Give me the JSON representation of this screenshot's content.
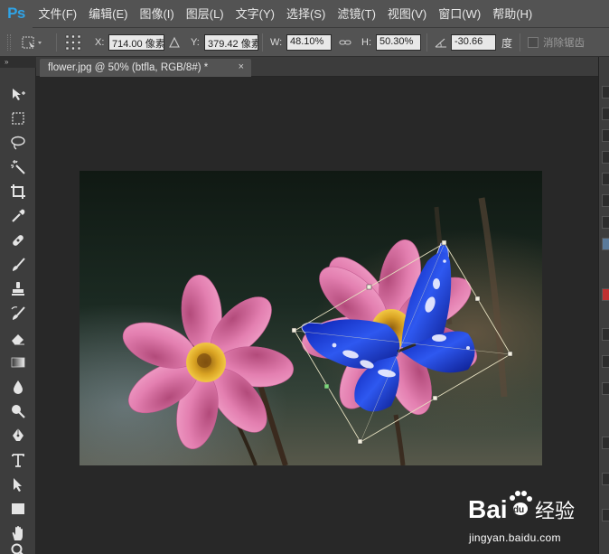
{
  "app": {
    "logo": "Ps"
  },
  "menu": [
    "文件(F)",
    "编辑(E)",
    "图像(I)",
    "图层(L)",
    "文字(Y)",
    "选择(S)",
    "滤镜(T)",
    "视图(V)",
    "窗口(W)",
    "帮助(H)"
  ],
  "options": {
    "x_label": "X:",
    "x_value": "714.00 像素",
    "y_label": "Y:",
    "y_value": "379.42 像素",
    "w_label": "W:",
    "w_value": "48.10%",
    "h_label": "H:",
    "h_value": "50.30%",
    "angle_value": "-30.66",
    "angle_unit": "度",
    "antialias_label": "消除锯齿",
    "antialias_checked": false
  },
  "document": {
    "tab_title": "flower.jpg @ 50% (btfla, RGB/8#) *",
    "close_glyph": "×"
  },
  "toolbar": {
    "collapse_glyph": "»",
    "tools": [
      "move-tool-icon",
      "marquee-tool-icon",
      "lasso-tool-icon",
      "magic-wand-icon",
      "crop-tool-icon",
      "eyedropper-icon",
      "healing-brush-icon",
      "brush-tool-icon",
      "clone-stamp-icon",
      "history-brush-icon",
      "eraser-icon",
      "gradient-tool-icon",
      "blur-tool-icon",
      "dodge-tool-icon",
      "pen-tool-icon",
      "type-tool-icon",
      "path-selection-icon",
      "rectangle-tool-icon",
      "hand-tool-icon",
      "zoom-tool-icon"
    ]
  },
  "watermark": {
    "brand": "Bai",
    "brand2": "经验",
    "url": "jingyan.baidu.com"
  },
  "colors": {
    "ui_dark": "#282828",
    "ui_mid": "#535353",
    "ps_blue": "#2fa3e6"
  }
}
